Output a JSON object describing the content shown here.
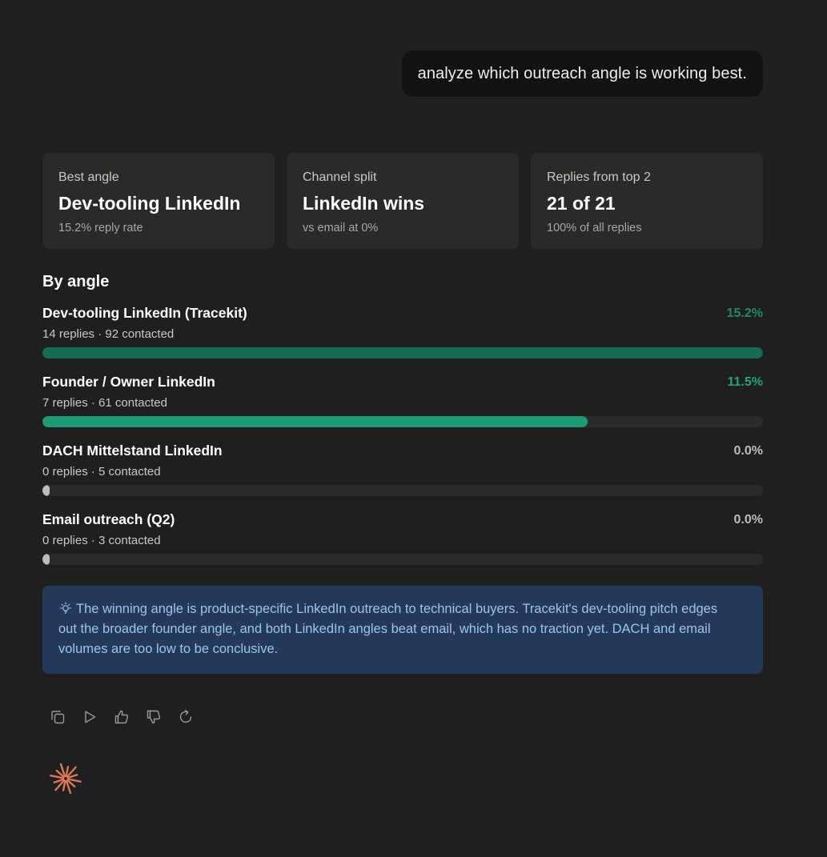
{
  "user_message": "analyze which outreach angle is working best.",
  "summary_cards": [
    {
      "label": "Best angle",
      "value": "Dev-tooling LinkedIn",
      "sub": "15.2% reply rate"
    },
    {
      "label": "Channel split",
      "value": "LinkedIn wins",
      "sub": "vs email at 0%"
    },
    {
      "label": "Replies from top 2",
      "value": "21 of 21",
      "sub": "100% of all replies"
    }
  ],
  "section_title": "By angle",
  "angles": [
    {
      "name": "Dev-tooling LinkedIn (Tracekit)",
      "meta": "14 replies · 92 contacted",
      "rate_label": "15.2%",
      "rate": 15.2,
      "color": "#156b53",
      "rate_color": "#1f8a6a"
    },
    {
      "name": "Founder / Owner LinkedIn",
      "meta": "7 replies · 61 contacted",
      "rate_label": "11.5%",
      "rate": 11.5,
      "color": "#1f9a76",
      "rate_color": "#22a47d"
    },
    {
      "name": "DACH Mittelstand LinkedIn",
      "meta": "0 replies · 5 contacted",
      "rate_label": "0.0%",
      "rate": 0.0,
      "color": "#bdbcb6",
      "rate_color": "#bdbcb6"
    },
    {
      "name": "Email outreach (Q2)",
      "meta": "0 replies · 3 contacted",
      "rate_label": "0.0%",
      "rate": 0.0,
      "color": "#bdbcb6",
      "rate_color": "#bdbcb6"
    }
  ],
  "max_rate": 15.2,
  "insight": {
    "icon": "lightbulb-icon",
    "text": "The winning angle is product-specific LinkedIn outreach to technical buyers. Tracekit's dev-tooling pitch edges out the broader founder angle, and both LinkedIn angles beat email, which has no traction yet. DACH and email volumes are too low to be conclusive."
  },
  "actions": [
    "copy-icon",
    "play-icon",
    "thumbs-up-icon",
    "thumbs-down-icon",
    "retry-icon"
  ],
  "colors": {
    "background": "#1f1f1f",
    "card": "#2a2a29",
    "insight_bg": "#253a5a",
    "insight_text": "#9dc2ee",
    "accent_logo": "#d97757"
  }
}
